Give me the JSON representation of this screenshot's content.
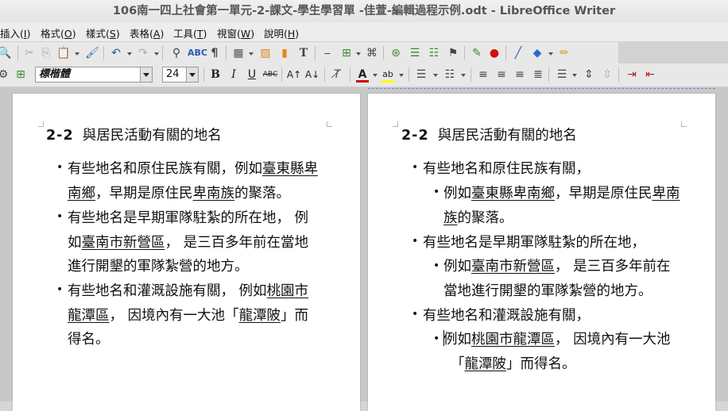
{
  "window": {
    "title": "106南一四上社會第一單元-2-課文-學生學習單 -佳萱-編輯過程示例.odt - LibreOffice Writer"
  },
  "menu": {
    "items": [
      {
        "label": "插入(",
        "key": "I",
        "end": ")"
      },
      {
        "label": "格式(",
        "key": "O",
        "end": ")"
      },
      {
        "label": "樣式(",
        "key": "S",
        "end": ")"
      },
      {
        "label": "表格(",
        "key": "A",
        "end": ")"
      },
      {
        "label": "工具(",
        "key": "T",
        "end": ")"
      },
      {
        "label": "視窗(",
        "key": "W",
        "end": ")"
      },
      {
        "label": "說明(",
        "key": "H",
        "end": ")"
      }
    ]
  },
  "formatting": {
    "font_name": "標楷體",
    "font_size": "24"
  },
  "colors": {
    "font_color_swatch": "#cc0000",
    "highlight_swatch": "#ffff00",
    "page_dashed_border": "#7a7ad6"
  },
  "left_page": {
    "heading_num": "2-2",
    "heading_text": "與居民活動有關的地名",
    "lines": [
      {
        "a": "有些地名和原住民族有關，例如",
        "u": "臺東縣卑",
        "b": ""
      },
      {
        "a": "",
        "u": "南鄉",
        "b": "，早期是原住民",
        "u2": "卑南族",
        "c": "的聚落。"
      },
      {
        "a": "有些地名是早期軍隊駐紮的所在地， 例",
        "u": "",
        "b": ""
      },
      {
        "a": "如",
        "u": "臺南市新營區",
        "b": "， 是三百多年前在當地"
      },
      {
        "a": "進行開墾的軍隊紮營的地方。",
        "u": "",
        "b": ""
      },
      {
        "a": "有些地名和灌溉設施有關， 例如",
        "u": "桃園市",
        "b": ""
      },
      {
        "a": "",
        "u": "龍潭區",
        "b": "， 因境內有一大池「",
        "u2": "龍潭陂",
        "c": "」而"
      },
      {
        "a": "得名。",
        "u": "",
        "b": ""
      }
    ]
  },
  "right_page": {
    "heading_num": "2-2",
    "heading_text": "與居民活動有關的地名",
    "lines": [
      {
        "a": "有些地名和原住民族有關，",
        "u": "",
        "b": ""
      },
      {
        "a": "例如",
        "u": "臺東縣卑南鄉",
        "b": "，早期是原住民",
        "u2": "卑南",
        "c": ""
      },
      {
        "a": "",
        "u": "族",
        "b": "的聚落。"
      },
      {
        "a": "有些地名是早期軍隊駐紮的所在地，",
        "u": "",
        "b": ""
      },
      {
        "a": "例如",
        "u": "臺南市新營區",
        "b": "， 是三百多年前在"
      },
      {
        "a": "當地進行開墾的軍隊紮營的地方。",
        "u": "",
        "b": ""
      },
      {
        "a": "有些地名和灌溉設施有關，",
        "u": "",
        "b": ""
      },
      {
        "a": "例如",
        "u": "桃園市龍潭區",
        "b": "， 因境內有一大池"
      },
      {
        "a": "「",
        "u": "龍潭陂",
        "b": "」而得名。"
      }
    ]
  }
}
